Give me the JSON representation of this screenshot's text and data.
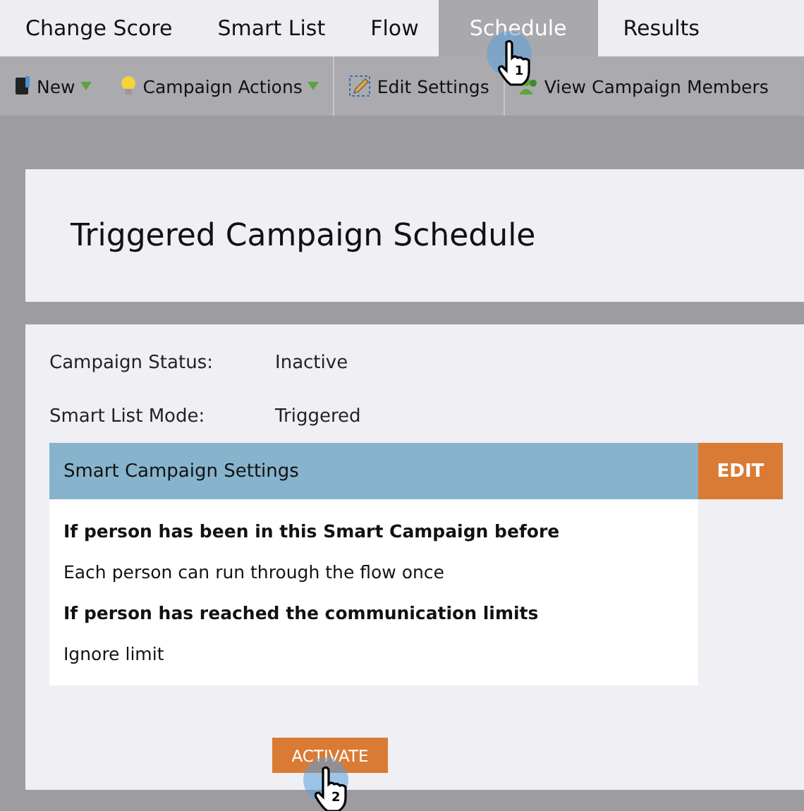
{
  "tabs": [
    {
      "label": "Change Score",
      "selected": false
    },
    {
      "label": "Smart List",
      "selected": false
    },
    {
      "label": "Flow",
      "selected": false
    },
    {
      "label": "Schedule",
      "selected": true,
      "step": "1"
    },
    {
      "label": "Results",
      "selected": false
    }
  ],
  "toolbar": [
    {
      "label": "New",
      "kind": "new",
      "dropdown": true
    },
    {
      "label": "Campaign Actions",
      "kind": "actions",
      "dropdown": true
    },
    {
      "label": "Edit Settings",
      "kind": "edit",
      "dropdown": false
    },
    {
      "label": "View Campaign Members",
      "kind": "members",
      "dropdown": false
    }
  ],
  "header": {
    "title": "Triggered Campaign Schedule"
  },
  "fields": [
    {
      "label": "Campaign Status:",
      "value": "Inactive"
    },
    {
      "label": "Smart List Mode:",
      "value": "Triggered"
    }
  ],
  "settings": {
    "title": "Smart Campaign Settings",
    "edit_button": "EDIT",
    "lines": [
      {
        "text": "If person has been in this Smart Campaign before",
        "kind": "heading"
      },
      {
        "text": "Each person can run through the flow once",
        "kind": "value"
      },
      {
        "text": "If person has reached the communication limits",
        "kind": "heading"
      },
      {
        "text": "Ignore limit",
        "kind": "value"
      }
    ]
  },
  "activate_button": {
    "label": "ACTIVATE",
    "step": "2"
  }
}
